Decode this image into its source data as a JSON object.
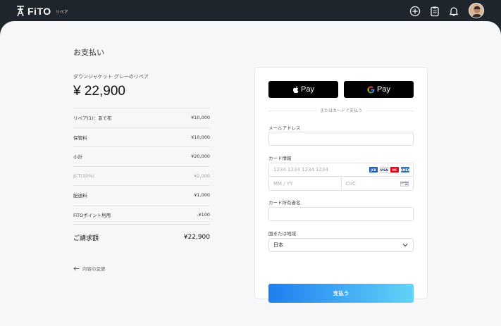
{
  "header": {
    "logo_text": "FiTO",
    "logo_subtitle": "リペア",
    "icons": [
      "plus-circle-icon",
      "clipboard-icon",
      "bell-icon"
    ]
  },
  "summary": {
    "page_title": "お支払い",
    "product_name": "ダウンジャケット グレーのリペア",
    "price": "¥ 22,900",
    "lines": [
      {
        "label": "リペア(1)：あて布",
        "value": "¥10,000",
        "muted": false
      },
      {
        "label": "保管料",
        "value": "¥10,000",
        "muted": false
      },
      {
        "label": "小計",
        "value": "¥20,000",
        "muted": false
      },
      {
        "label": "JCT(10%)",
        "value": "¥2,000",
        "muted": true
      },
      {
        "label": "配送料",
        "value": "¥1,000",
        "muted": false
      },
      {
        "label": "FiTOポイント利用",
        "value": "-¥100",
        "muted": false
      }
    ],
    "total_label": "ご請求額",
    "total_value": "¥22,900",
    "back_link": "内容の変更"
  },
  "payment": {
    "apple_pay_label": "Pay",
    "google_pay_label": "Pay",
    "divider_text": "またはカードで支払う",
    "email_label": "メールアドレス",
    "email_value": "",
    "card_label": "カード情報",
    "card_number_placeholder": "1234 1234 1234 1234",
    "card_brands": [
      "JCB",
      "VISA",
      "MC",
      "AMEX"
    ],
    "expiry_placeholder": "MM / YY",
    "cvc_placeholder": "CVC",
    "holder_label": "カード所有者名",
    "holder_value": "",
    "country_label": "国または地域",
    "country_value": "日本",
    "submit_label": "支払う"
  },
  "colors": {
    "topbar": "#1f252d",
    "background": "#f6f7f9",
    "button_gradient_start": "#1e7ef0",
    "button_gradient_end": "#62d3f7"
  }
}
